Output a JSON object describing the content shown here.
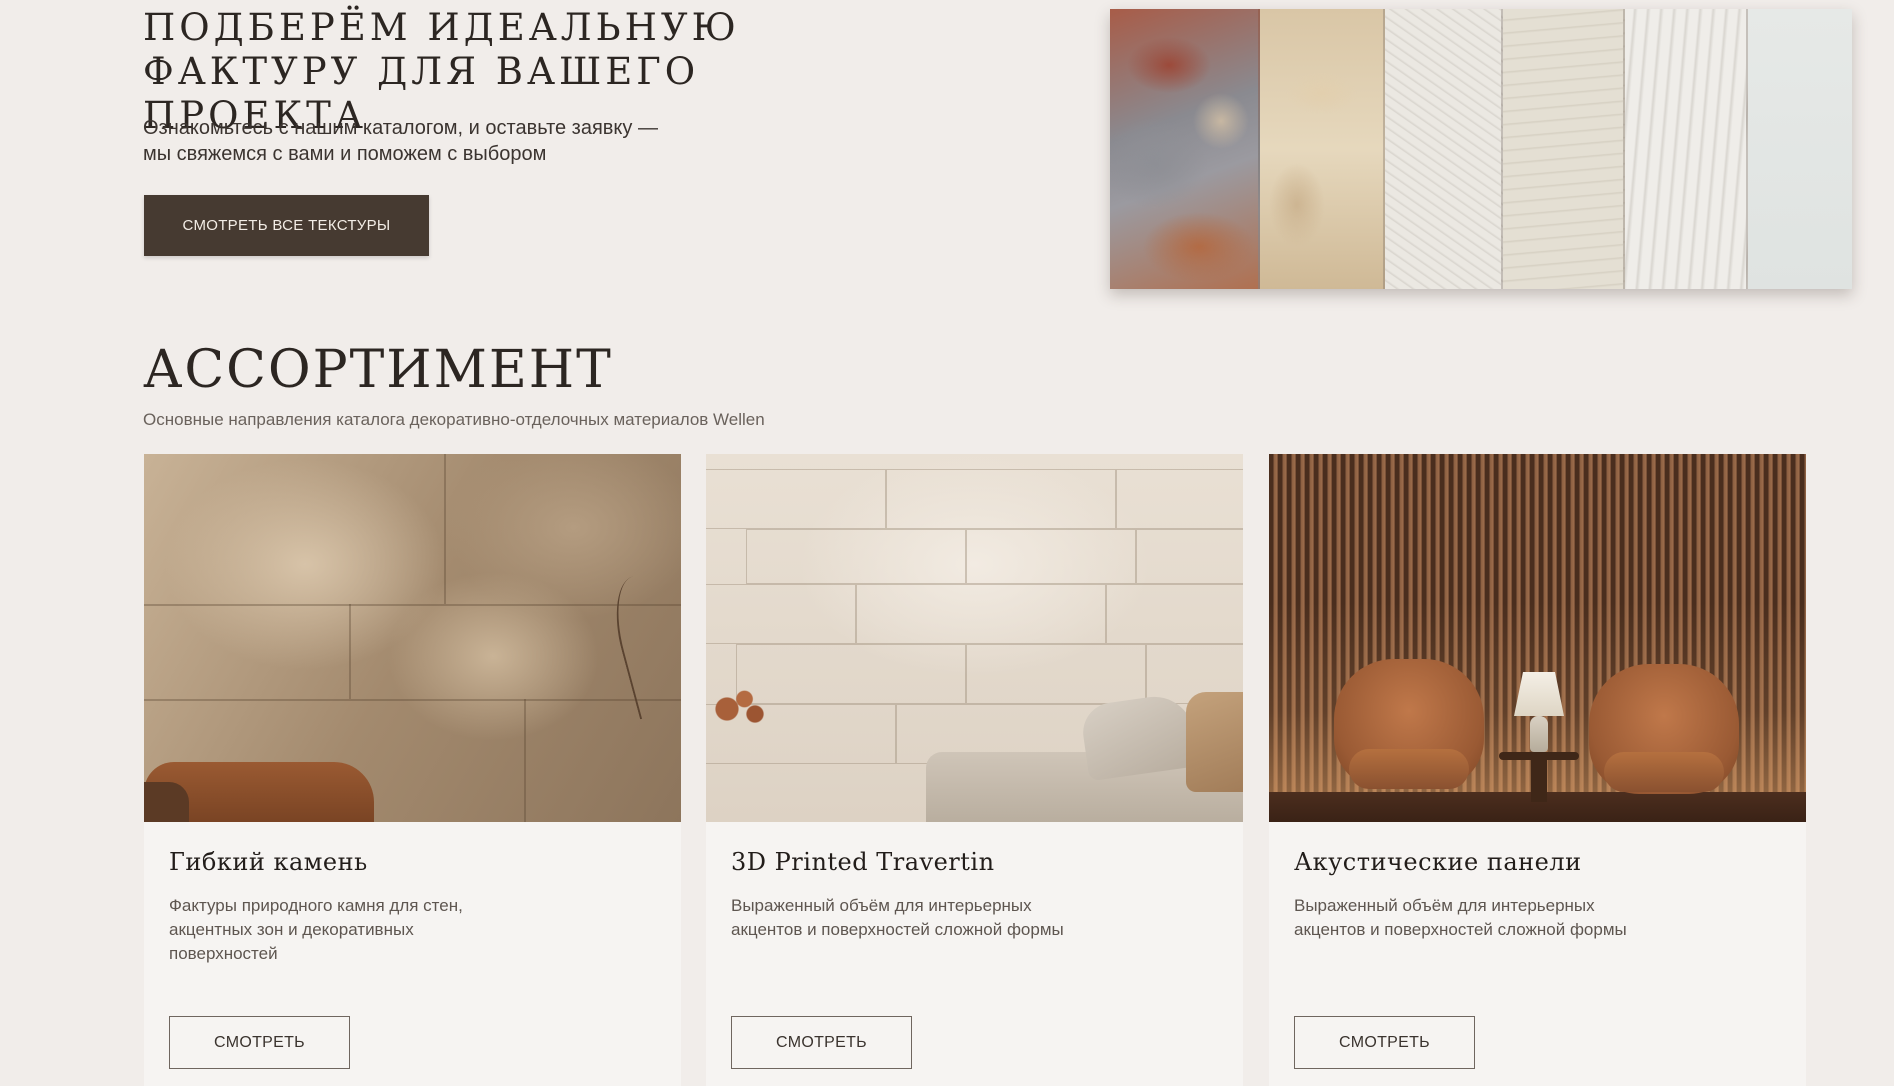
{
  "hero": {
    "title_line1": "Подберём идеальную",
    "title_line2": "фактуру для вашего проекта",
    "subtitle_line1": "Ознакомьтесь с нашим каталогом, и оставьте заявку —",
    "subtitle_line2": "мы свяжемся с вами и поможем с выбором",
    "button_label": "СМОТРЕТЬ ВСЕ ТЕКСТУРЫ"
  },
  "assortment": {
    "title": "АССОРТИМЕНТ",
    "subtitle": "Основные направления каталога декоративно-отделочных материалов Wellen",
    "cards": [
      {
        "title": "Гибкий камень",
        "description": "Фактуры природного камня для стен, акцентных зон и декоративных поверхностей",
        "button_label": "СМОТРЕТЬ"
      },
      {
        "title": "3D Printed Travertin",
        "description": "Выраженный объём для интерьерных акцентов и поверхностей сложной формы",
        "button_label": "СМОТРЕТЬ"
      },
      {
        "title": "Акустические панели",
        "description": "Выраженный объём для интерьерных акцентов и поверхностей сложной формы",
        "button_label": "СМОТРЕТЬ"
      }
    ]
  },
  "colors": {
    "background": "#f1edea",
    "primary_button": "#463a31",
    "card_background": "#f6f4f2"
  }
}
